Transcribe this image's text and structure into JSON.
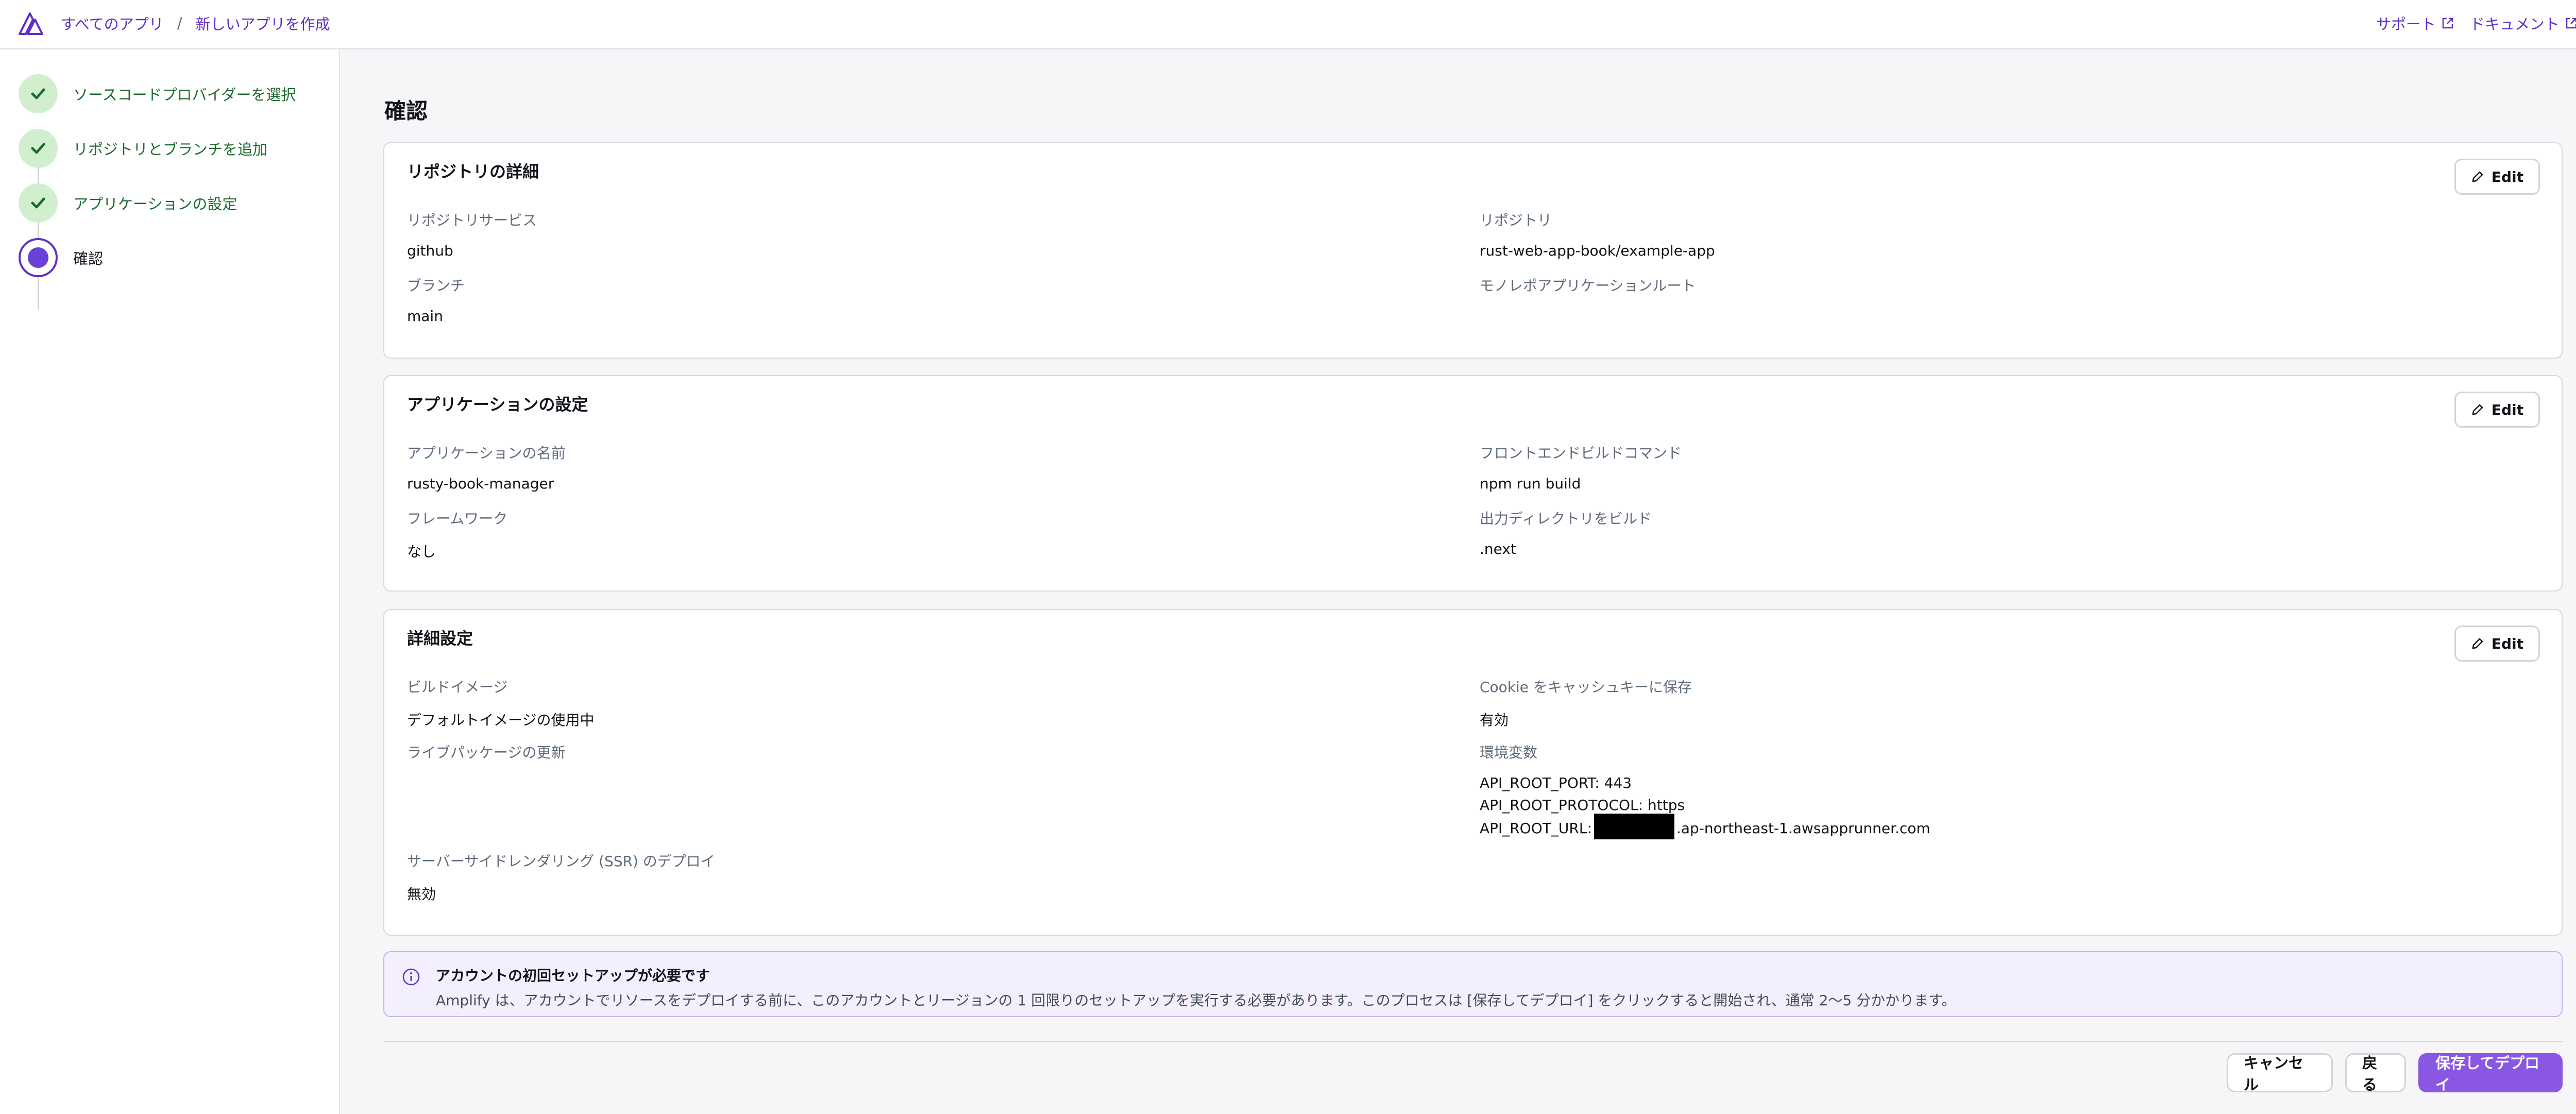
{
  "breadcrumb": {
    "root": "すべてのアプリ",
    "separator": "/",
    "current": "新しいアプリを作成"
  },
  "header_links": {
    "support": "サポート",
    "docs": "ドキュメント"
  },
  "steps": [
    {
      "label": "ソースコードプロバイダーを選択",
      "status": "done"
    },
    {
      "label": "リポジトリとブランチを追加",
      "status": "done"
    },
    {
      "label": "アプリケーションの設定",
      "status": "done"
    },
    {
      "label": "確認",
      "status": "current"
    }
  ],
  "page_title": "確認",
  "edit_label": "Edit",
  "repo_details": {
    "title": "リポジトリの詳細",
    "service_label": "リポジトリサービス",
    "service_value": "github",
    "repo_label": "リポジトリ",
    "repo_value": "rust-web-app-book/example-app",
    "branch_label": "ブランチ",
    "branch_value": "main",
    "monorepo_label": "モノレポアプリケーションルート"
  },
  "app_settings": {
    "title": "アプリケーションの設定",
    "name_label": "アプリケーションの名前",
    "name_value": "rusty-book-manager",
    "build_cmd_label": "フロントエンドビルドコマンド",
    "build_cmd_value": "npm run build",
    "framework_label": "フレームワーク",
    "framework_value": "なし",
    "output_dir_label": "出力ディレクトリをビルド",
    "output_dir_value": ".next"
  },
  "advanced": {
    "title": "詳細設定",
    "build_image_label": "ビルドイメージ",
    "build_image_value": "デフォルトイメージの使用中",
    "cookie_label": "Cookie をキャッシュキーに保存",
    "cookie_value": "有効",
    "live_pkg_label": "ライブパッケージの更新",
    "env_label": "環境変数",
    "env": {
      "port_key": "API_ROOT_PORT:",
      "port_value": "443",
      "protocol_key": "API_ROOT_PROTOCOL:",
      "protocol_value": "https",
      "url_key": "API_ROOT_URL:",
      "url_suffix": ".ap-northeast-1.awsapprunner.com"
    },
    "ssr_label": "サーバーサイドレンダリング (SSR) のデプロイ",
    "ssr_value": "無効"
  },
  "alert": {
    "title": "アカウントの初回セットアップが必要です",
    "text": "Amplify は、アカウントでリソースをデプロイする前に、このアカウントとリージョンの 1 回限りのセットアップを実行する必要があります。このプロセスは [保存してデプロイ] をクリックすると開始され、通常 2〜5 分かかります。"
  },
  "footer": {
    "cancel": "キャンセル",
    "back": "戻る",
    "deploy": "保存してデプロイ"
  },
  "colors": {
    "accent": "#5f2fc8",
    "primary_button": "#8a57e3",
    "done_step": "#d1efcf"
  }
}
